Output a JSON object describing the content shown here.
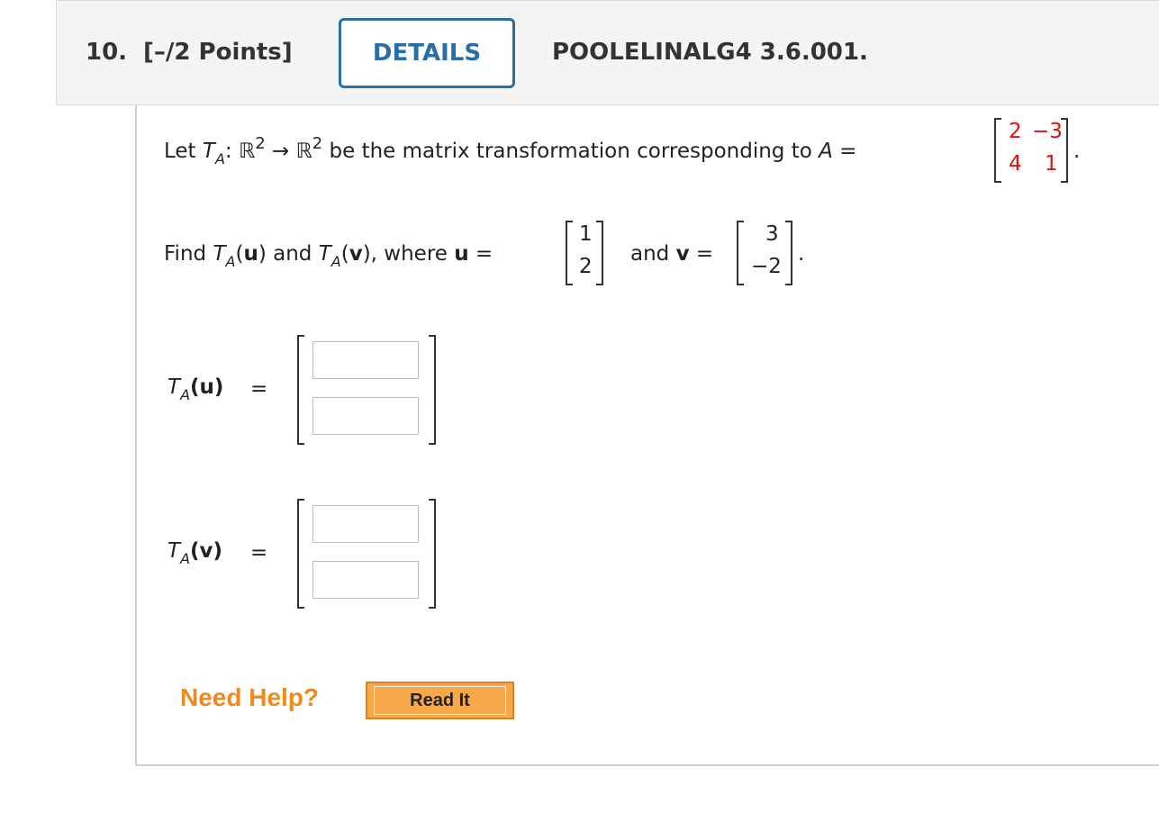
{
  "header": {
    "question_number": "10.",
    "points": "[–/2 Points]",
    "details_label": "DETAILS",
    "problem_code": "POOLELINALG4 3.6.001."
  },
  "problem": {
    "line1_let": "Let ",
    "T": "T",
    "A": "A",
    "colon_R": ": ℝ",
    "exp2": "2",
    "arrow_R": " → ℝ",
    "line1_rest": " be the matrix transformation corresponding to ",
    "A_eq": "A",
    "eq": " =",
    "matrix_A": [
      "2",
      "−3",
      "4",
      "1"
    ],
    "period": ".",
    "line2_find": "Find ",
    "u_open": "(",
    "u": "u",
    "v": "v",
    "close_and": ") and ",
    "close_where": "), where ",
    "u_eq": " =",
    "and": "and ",
    "v_eq": " =",
    "vector_u": [
      "1",
      "2"
    ],
    "vector_v": [
      "3",
      "−2"
    ]
  },
  "answers": {
    "tau_label": "(u)",
    "tav_label": "(v)",
    "equals": "="
  },
  "help": {
    "need_help": "Need Help?",
    "read_it": "Read It"
  }
}
